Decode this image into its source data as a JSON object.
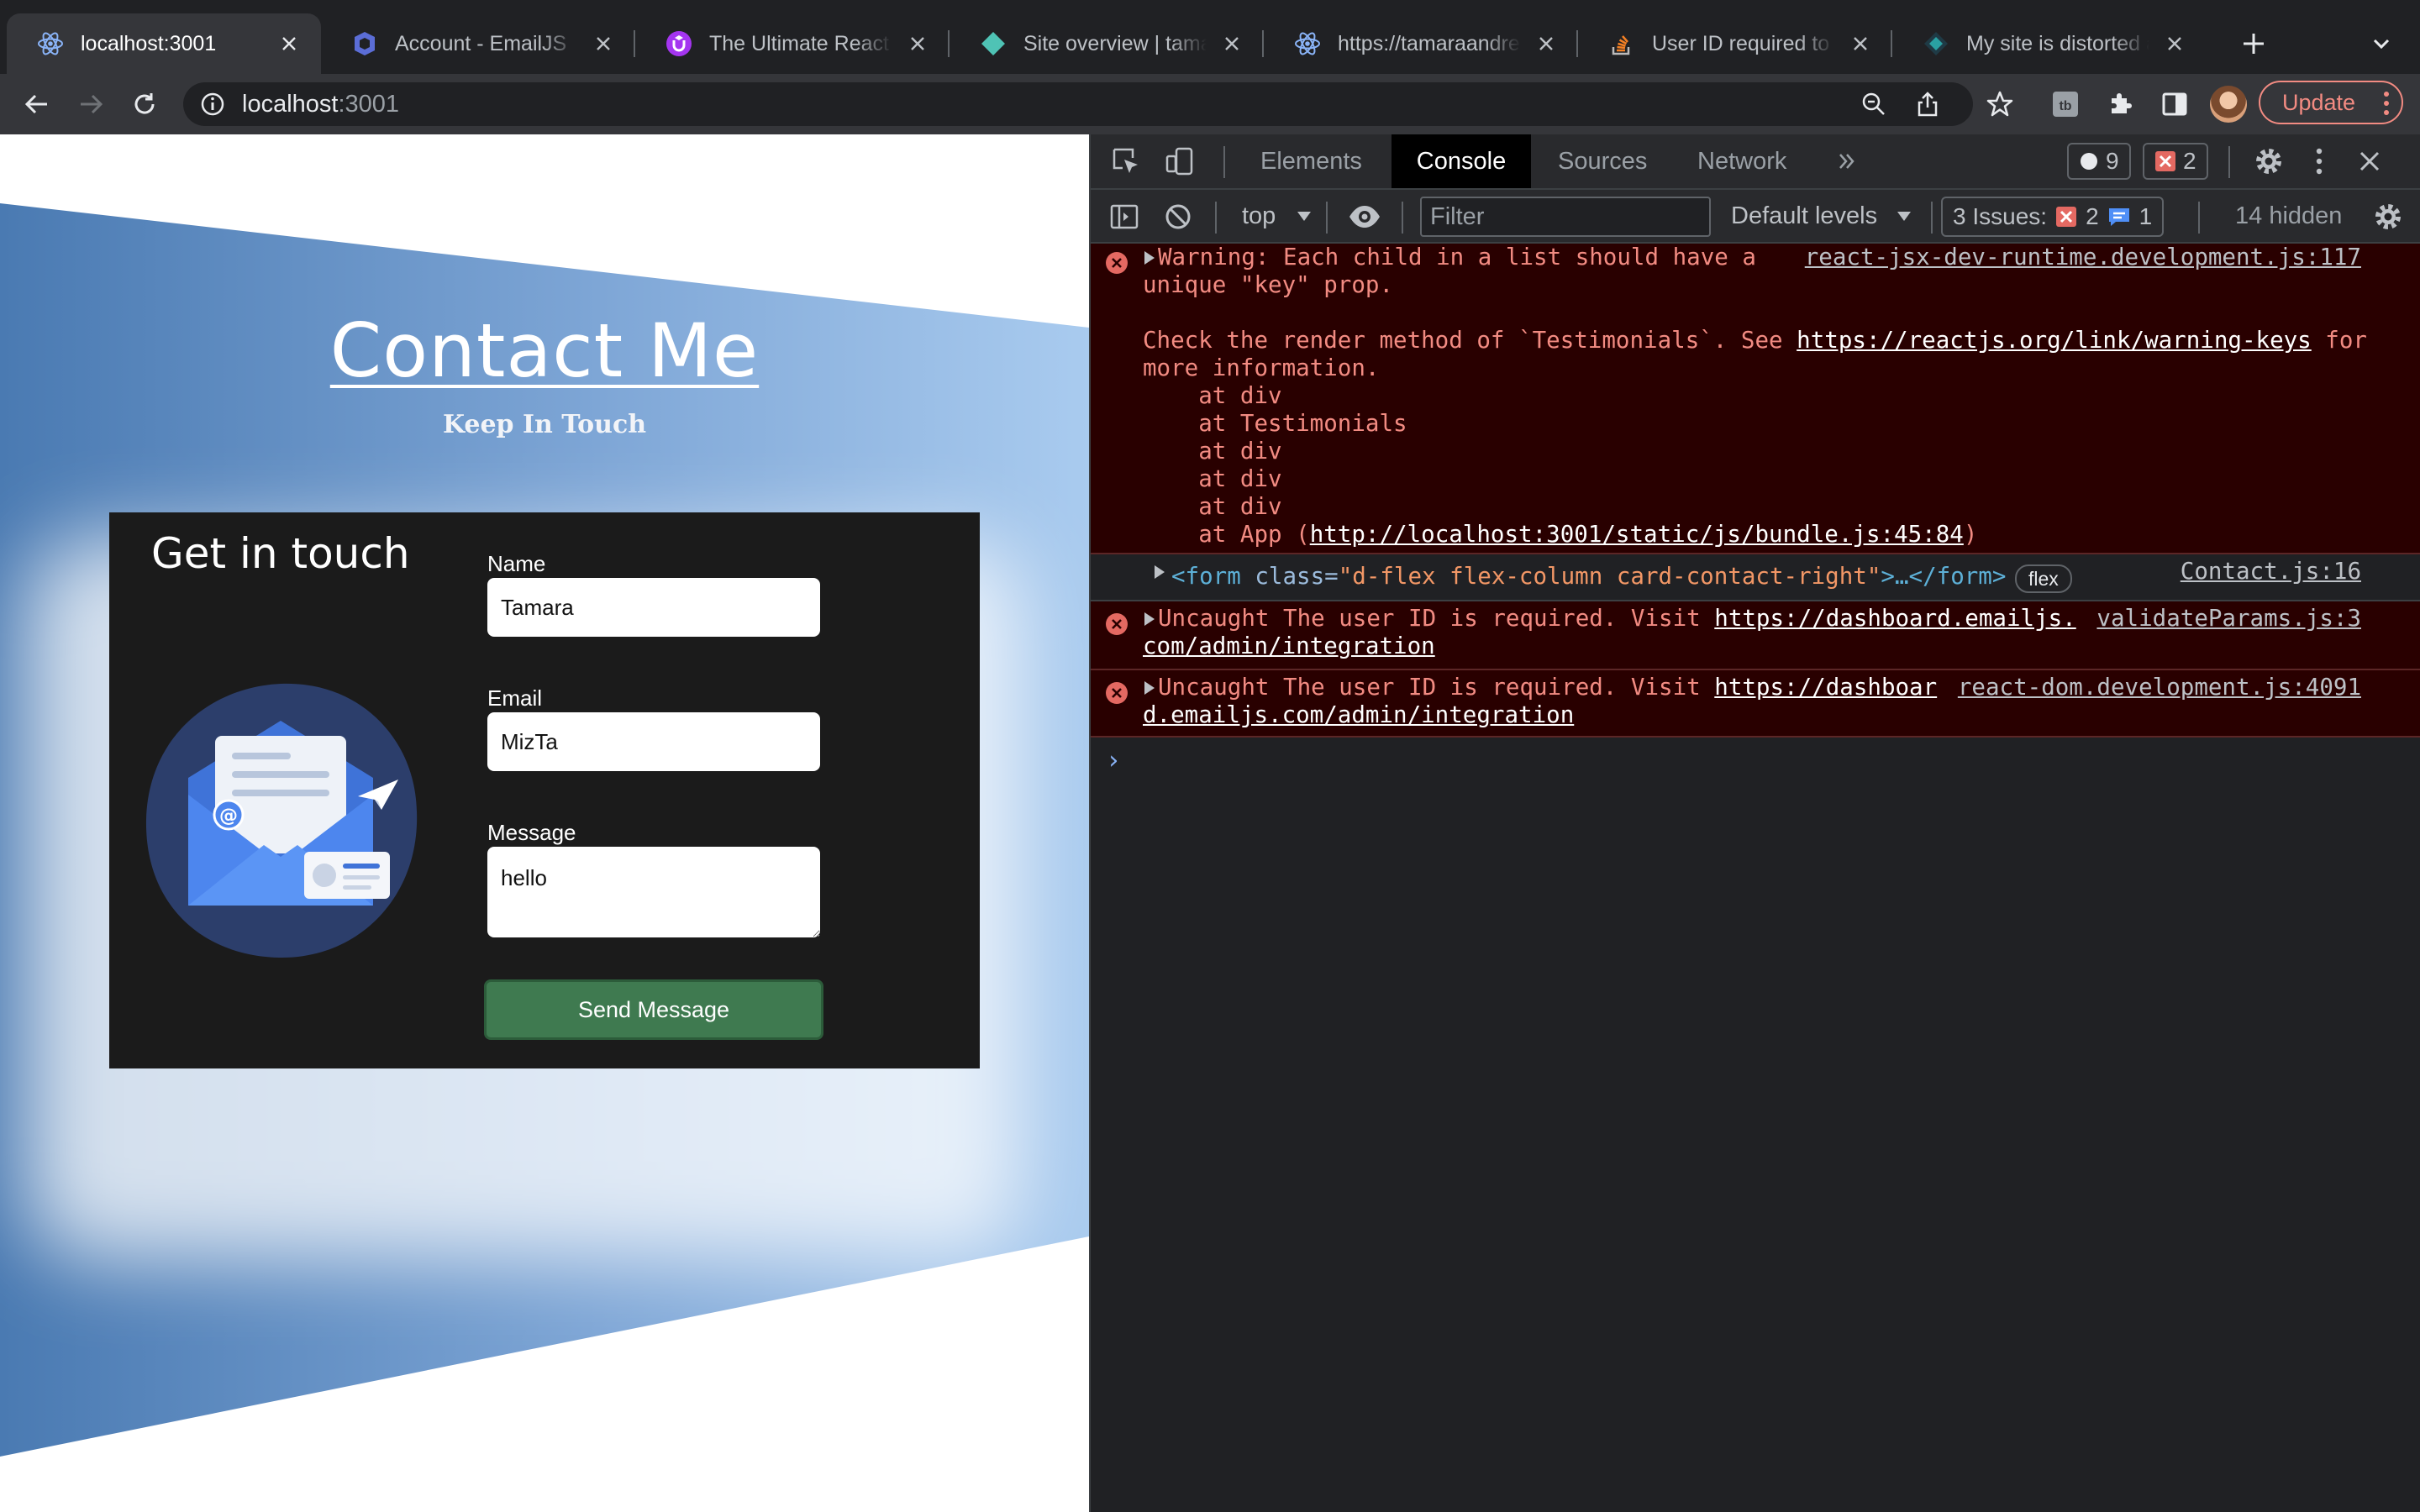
{
  "tabs": [
    {
      "title": "localhost:3001",
      "active": true
    },
    {
      "title": "Account - EmailJS",
      "active": false
    },
    {
      "title": "The Ultimate React JS",
      "active": false
    },
    {
      "title": "Site overview | tamaraandrea",
      "active": false
    },
    {
      "title": "https://tamaraandrea",
      "active": false
    },
    {
      "title": "User ID required to send",
      "active": false
    },
    {
      "title": "My site is distorted after",
      "active": false
    }
  ],
  "toolbar": {
    "url_host": "localhost",
    "url_port": ":3001",
    "update_label": "Update"
  },
  "page": {
    "title": "Contact Me",
    "subtitle": "Keep In Touch",
    "card_heading": "Get in touch",
    "name_label": "Name",
    "name_value": "Tamara",
    "email_label": "Email",
    "email_value": "MizTa",
    "message_label": "Message",
    "message_value": "hello",
    "send_label": "Send Message"
  },
  "devtools": {
    "tabs": [
      "Elements",
      "Console",
      "Sources",
      "Network"
    ],
    "active_tab": "Console",
    "info_count": "9",
    "error_count": "2",
    "context": "top",
    "filter_placeholder": "Filter",
    "levels": "Default levels",
    "issues_label": "3 Issues:",
    "issues_errors": "2",
    "issues_info": "1",
    "hidden": "14 hidden"
  },
  "console": {
    "warning": {
      "line1": "Warning: Each child in a list should have a",
      "line2": "unique \"key\" prop.",
      "line3a": "Check the render method of `Testimonials`. See ",
      "line3_link": "https://reactjs.org/link/warning-keys",
      "line3b": " for",
      "line4": "more information.",
      "stack": [
        "    at div",
        "    at Testimonials",
        "    at div",
        "    at div",
        "    at div"
      ],
      "stack_app_prefix": "    at App (",
      "stack_app_link": "http://localhost:3001/static/js/bundle.js:45:84",
      "stack_app_suffix": ")",
      "source": "react-jsx-dev-runtime.development.js:117"
    },
    "form_log": {
      "tag_open": "<form",
      "attr": " class=",
      "value": "\"d-flex flex-column card-contact-right\"",
      "rest": ">…</form>",
      "badge": "flex",
      "source": "Contact.js:16"
    },
    "error1": {
      "text": "Uncaught The user ID is required. Visit ",
      "link_a": "https://dashboard.emailjs.",
      "link_b": "com/admin/integration",
      "source": "validateParams.js:3"
    },
    "error2": {
      "text": "Uncaught The user ID is required. Visit ",
      "link_a": "https://dashboar",
      "link_b": "d.emailjs.com/admin/integration",
      "source": "react-dom.development.js:4091"
    }
  }
}
